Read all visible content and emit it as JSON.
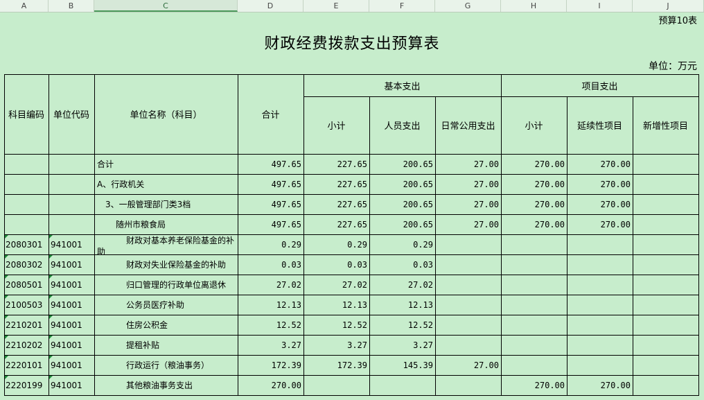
{
  "columns": [
    "A",
    "B",
    "C",
    "D",
    "E",
    "F",
    "G",
    "H",
    "I",
    "J"
  ],
  "selected_column": "C",
  "sheet": {
    "corner_label": "预算10表",
    "title": "财政经费拨款支出预算表",
    "unit": "单位：万元"
  },
  "header": {
    "subject_code": "科目编码",
    "unit_code": "单位代码",
    "unit_name": "单位名称（科目）",
    "total": "合计",
    "basic_group": "基本支出",
    "basic_subtotal": "小计",
    "personnel": "人员支出",
    "daily": "日常公用支出",
    "project_group": "项目支出",
    "project_subtotal": "小计",
    "continuing": "延续性项目",
    "new_project": "新增性项目"
  },
  "rows": [
    {
      "code": "",
      "unit": "",
      "name": "合计",
      "indent": 0,
      "total": "497.65",
      "basic": "227.65",
      "personnel": "200.65",
      "daily": "27.00",
      "project": "270.00",
      "continuing": "270.00",
      "new": ""
    },
    {
      "code": "",
      "unit": "",
      "name": "A、行政机关",
      "indent": 0,
      "total": "497.65",
      "basic": "227.65",
      "personnel": "200.65",
      "daily": "27.00",
      "project": "270.00",
      "continuing": "270.00",
      "new": ""
    },
    {
      "code": "",
      "unit": "",
      "name": "3、一般管理部门类3档",
      "indent": 1,
      "total": "497.65",
      "basic": "227.65",
      "personnel": "200.65",
      "daily": "27.00",
      "project": "270.00",
      "continuing": "270.00",
      "new": ""
    },
    {
      "code": "",
      "unit": "",
      "name": "随州市粮食局",
      "indent": 2,
      "total": "497.65",
      "basic": "227.65",
      "personnel": "200.65",
      "daily": "27.00",
      "project": "270.00",
      "continuing": "270.00",
      "new": ""
    },
    {
      "code": "2080301",
      "unit": "941001",
      "name": "财政对基本养老保险基金的补助",
      "indent": 3,
      "wrap": true,
      "total": "0.29",
      "basic": "0.29",
      "personnel": "0.29",
      "daily": "",
      "project": "",
      "continuing": "",
      "new": ""
    },
    {
      "code": "2080302",
      "unit": "941001",
      "name": "财政对失业保险基金的补助",
      "indent": 3,
      "total": "0.03",
      "basic": "0.03",
      "personnel": "0.03",
      "daily": "",
      "project": "",
      "continuing": "",
      "new": ""
    },
    {
      "code": "2080501",
      "unit": "941001",
      "name": "归口管理的行政单位离退休",
      "indent": 3,
      "total": "27.02",
      "basic": "27.02",
      "personnel": "27.02",
      "daily": "",
      "project": "",
      "continuing": "",
      "new": ""
    },
    {
      "code": "2100503",
      "unit": "941001",
      "name": "公务员医疗补助",
      "indent": 3,
      "total": "12.13",
      "basic": "12.13",
      "personnel": "12.13",
      "daily": "",
      "project": "",
      "continuing": "",
      "new": ""
    },
    {
      "code": "2210201",
      "unit": "941001",
      "name": "住房公积金",
      "indent": 3,
      "total": "12.52",
      "basic": "12.52",
      "personnel": "12.52",
      "daily": "",
      "project": "",
      "continuing": "",
      "new": ""
    },
    {
      "code": "2210202",
      "unit": "941001",
      "name": "提租补贴",
      "indent": 3,
      "total": "3.27",
      "basic": "3.27",
      "personnel": "3.27",
      "daily": "",
      "project": "",
      "continuing": "",
      "new": ""
    },
    {
      "code": "2220101",
      "unit": "941001",
      "name": "行政运行（粮油事务）",
      "indent": 3,
      "total": "172.39",
      "basic": "172.39",
      "personnel": "145.39",
      "daily": "27.00",
      "project": "",
      "continuing": "",
      "new": ""
    },
    {
      "code": "2220199",
      "unit": "941001",
      "name": "其他粮油事务支出",
      "indent": 3,
      "total": "270.00",
      "basic": "",
      "personnel": "",
      "daily": "",
      "project": "270.00",
      "continuing": "270.00",
      "new": ""
    }
  ]
}
